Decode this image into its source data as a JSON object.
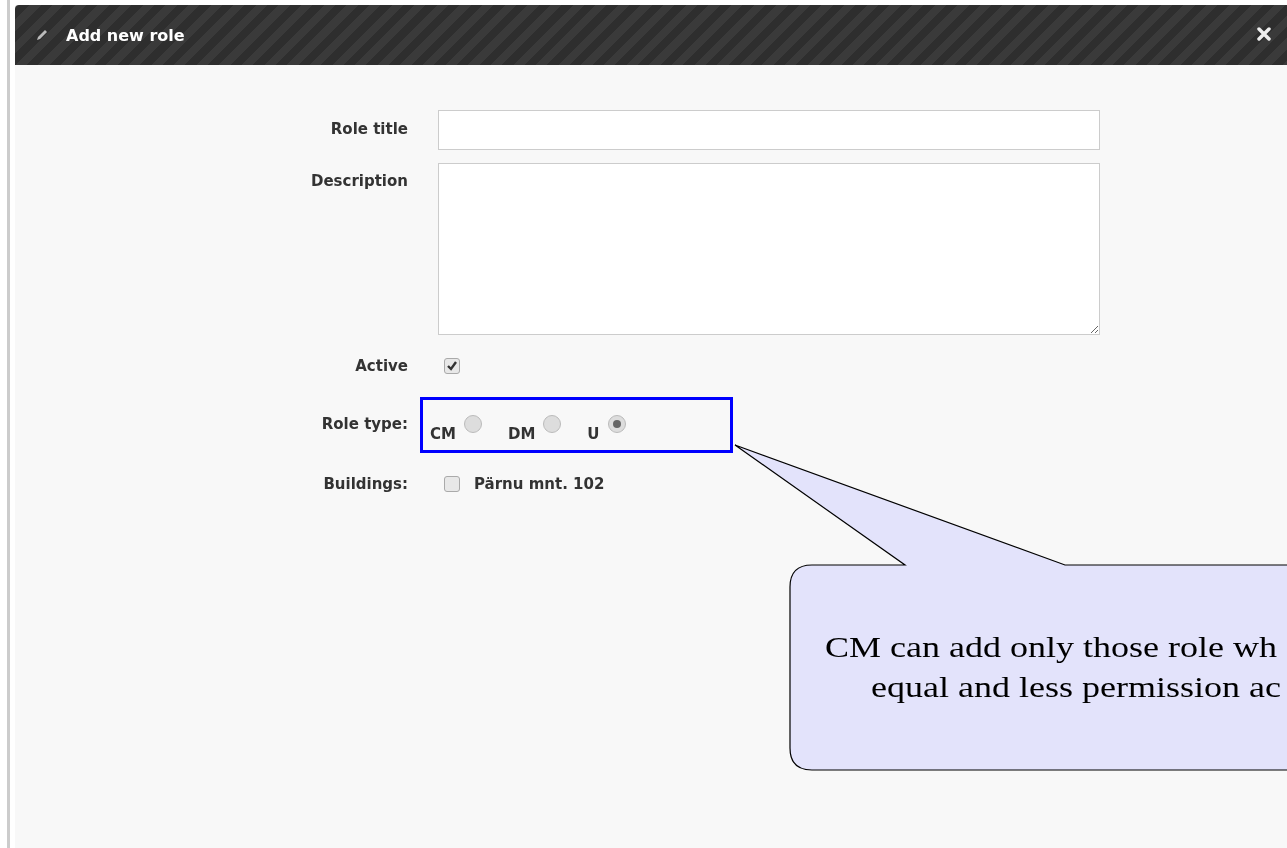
{
  "dialog": {
    "title": "Add new role"
  },
  "form": {
    "role_title_label": "Role title",
    "description_label": "Description",
    "active_label": "Active",
    "active": {
      "checked": true
    },
    "role_type_label": "Role type:",
    "role_types": [
      {
        "label": "CM",
        "selected": false
      },
      {
        "label": "DM",
        "selected": false
      },
      {
        "label": "U",
        "selected": true
      }
    ],
    "buildings_label": "Buildings:",
    "buildings": [
      {
        "label": "Pärnu mnt. 102",
        "checked": false
      }
    ]
  },
  "callout": {
    "lines": [
      "CM can add only those role wh",
      "equal and less permission ac"
    ]
  }
}
